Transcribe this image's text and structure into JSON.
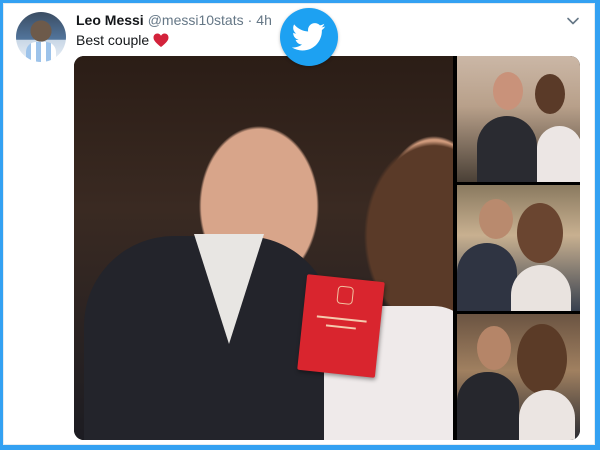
{
  "tweet": {
    "author_name": "Leo Messi",
    "handle": "@messi10stats",
    "separator": "·",
    "time": "4h",
    "text": "Best couple"
  },
  "icons": {
    "avatar": "profile-avatar",
    "bird": "twitter-bird-icon",
    "more": "chevron-down-icon",
    "emoji": "red-heart-icon"
  },
  "colors": {
    "frame": "#33a1f2",
    "twitter_blue": "#1da1f2",
    "heart_red": "#d3223b",
    "booklet_red": "#d9252e"
  }
}
